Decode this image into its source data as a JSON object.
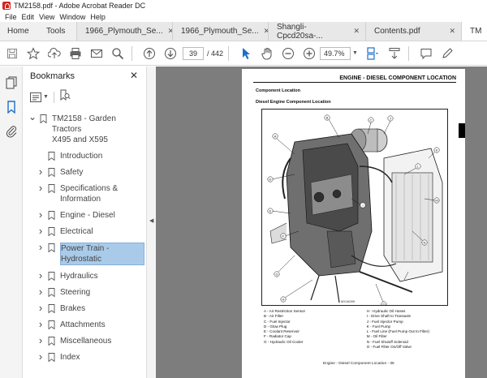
{
  "window": {
    "title": "TM2158.pdf - Adobe Acrobat Reader DC"
  },
  "menu": [
    "File",
    "Edit",
    "View",
    "Window",
    "Help"
  ],
  "tabs": {
    "nav": [
      "Home",
      "Tools"
    ],
    "docs": [
      {
        "label": "1966_Plymouth_Se...",
        "active": false
      },
      {
        "label": "1966_Plymouth_Se...",
        "active": false
      },
      {
        "label": "Shangli-Cpcd20sa-...",
        "active": false
      },
      {
        "label": "Contents.pdf",
        "active": false
      },
      {
        "label": "TM",
        "active": true
      }
    ]
  },
  "toolbar": {
    "page_current": "39",
    "page_total": "/ 442",
    "zoom": "49.7%"
  },
  "bookmarks": {
    "title": "Bookmarks",
    "items": [
      {
        "label": "TM2158 - Garden Tractors X495 and X595",
        "lines": [
          "TM2158 - Garden Tractors",
          "X495 and X595"
        ],
        "level": 0,
        "chevron": "down",
        "selected": false
      },
      {
        "label": "Introduction",
        "lines": [
          "Introduction"
        ],
        "level": 1,
        "chevron": "",
        "selected": false
      },
      {
        "label": "Safety",
        "lines": [
          "Safety"
        ],
        "level": 1,
        "chevron": "right",
        "selected": false
      },
      {
        "label": "Specifications & Information",
        "lines": [
          "Specifications &",
          "Information"
        ],
        "level": 1,
        "chevron": "right",
        "selected": false
      },
      {
        "label": "Engine - Diesel",
        "lines": [
          "Engine - Diesel"
        ],
        "level": 1,
        "chevron": "right",
        "selected": false
      },
      {
        "label": "Electrical",
        "lines": [
          "Electrical"
        ],
        "level": 1,
        "chevron": "right",
        "selected": false
      },
      {
        "label": "Power Train - Hydrostatic",
        "lines": [
          "Power Train -",
          "Hydrostatic"
        ],
        "level": 1,
        "chevron": "right",
        "selected": true
      },
      {
        "label": "Hydraulics",
        "lines": [
          "Hydraulics"
        ],
        "level": 1,
        "chevron": "right",
        "selected": false
      },
      {
        "label": "Steering",
        "lines": [
          "Steering"
        ],
        "level": 1,
        "chevron": "right",
        "selected": false
      },
      {
        "label": "Brakes",
        "lines": [
          "Brakes"
        ],
        "level": 1,
        "chevron": "right",
        "selected": false
      },
      {
        "label": "Attachments",
        "lines": [
          "Attachments"
        ],
        "level": 1,
        "chevron": "right",
        "selected": false
      },
      {
        "label": "Miscellaneous",
        "lines": [
          "Miscellaneous"
        ],
        "level": 1,
        "chevron": "right",
        "selected": false
      },
      {
        "label": "Index",
        "lines": [
          "Index"
        ],
        "level": 1,
        "chevron": "right",
        "selected": false
      }
    ]
  },
  "document": {
    "header": "ENGINE - DIESEL   COMPONENT LOCATION",
    "sub1": "Component Location",
    "sub2": "Diesel Engine Component Location",
    "figure_id": "MX16099",
    "callouts": [
      "A",
      "B",
      "C",
      "D",
      "E",
      "F",
      "G",
      "H",
      "I",
      "J",
      "K",
      "L",
      "M",
      "N",
      "O"
    ],
    "legend_left": [
      "A - Air Restriction Sensor",
      "B - Air Filter",
      "C - Fuel Injector",
      "D - Glow Plug",
      "E - Coolant Reservoir",
      "F - Radiator Cap",
      "G - Hydraulic Oil Cooler"
    ],
    "legend_right": [
      "H - Hydraulic Oil Hoses",
      "I  - Drive Shaft to Transaxle",
      "J - Fuel Injector Pump",
      "K - Fuel Pump",
      "L - Fuel Line (Fuel Pump Out to Filter)",
      "M - Oil Filter",
      "N - Fuel Shutoff Solenoid",
      "O - Fuel Filter On/Off Valve"
    ],
    "footer": "Engine - Diesel   Component Location - 35"
  },
  "colors": {
    "accent": "#d4241c",
    "selection": "#a9cbe9",
    "doc_bg": "#7d7d7d",
    "toolbar_blue": "#1f6fc7"
  }
}
